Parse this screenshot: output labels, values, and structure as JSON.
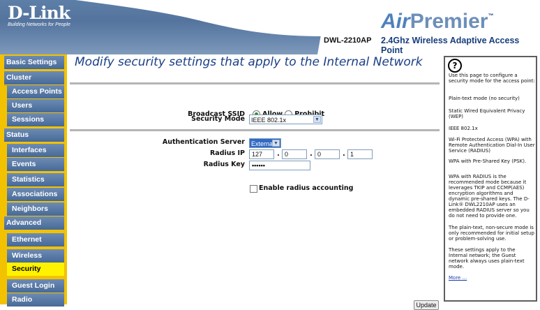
{
  "header": {
    "logo": "D-Link",
    "tagline": "Building Networks for People",
    "brand_air": "Air",
    "brand_premier": "Premier",
    "brand_tm": "™",
    "model": "DWL-2210AP",
    "product": "2.4Ghz Wireless Adaptive Access Point"
  },
  "nav": {
    "basic_settings": "Basic Settings",
    "cluster": "Cluster",
    "access_points": "Access Points",
    "users": "Users",
    "sessions": "Sessions",
    "status": "Status",
    "interfaces": "Interfaces",
    "events": "Events",
    "statistics": "Statistics",
    "associations": "Associations",
    "neighbors": "Neighbors",
    "advanced": "Advanced",
    "ethernet": "Ethernet",
    "wireless": "Wireless",
    "security": "Security",
    "guest_login": "Guest Login",
    "radio": "Radio"
  },
  "main": {
    "title": "Modify security settings that apply to the Internal Network",
    "broadcast_ssid_label": "Broadcast SSID",
    "allow_label": "Allow",
    "prohibit_label": "Prohibit",
    "security_mode_label": "Security Mode",
    "security_mode_value": "IEEE 802.1x",
    "auth_server_label": "Authentication Server",
    "auth_server_value": "External",
    "radius_ip_label": "Radius IP",
    "radius_ip": [
      "127",
      "0",
      "0",
      "1"
    ],
    "radius_key_label": "Radius Key",
    "radius_key_value": "••••••",
    "enable_accounting_label": "Enable radius accounting",
    "update_button": "Update"
  },
  "help": {
    "icon": "?",
    "p1": "Use this page to configure a security mode for the access point:",
    "p2": "Plain-text mode (no security)",
    "p3": "Static Wired Equivalent Privacy (WEP)",
    "p4": "IEEE 802.1x",
    "p5": "Wi-Fi Protected Access (WPA) with Remote Authentication Dial-In User Service (RADIUS)",
    "p6": "WPA with Pre-Shared Key (PSK).",
    "p7": "WPA with RADIUS is the recommended mode because it leverages TKIP and CCMP(AES) encryption algorithms and dynamic pre-shared keys. The D-Link® DWL2210AP uses an embedded RADIUS server so you do not need to provide one.",
    "p8": "The plain-text, non-secure mode is only recommended for initial setup or problem-solving use.",
    "p9": "These settings apply to the Internal network; the Guest network always uses plain-text mode.",
    "more": "More ..."
  },
  "colors": {
    "sidebar": "#f2c200",
    "nav_button": "#476a98",
    "nav_active": "#fff200",
    "title": "#1a3f86",
    "header": "#54749e"
  }
}
